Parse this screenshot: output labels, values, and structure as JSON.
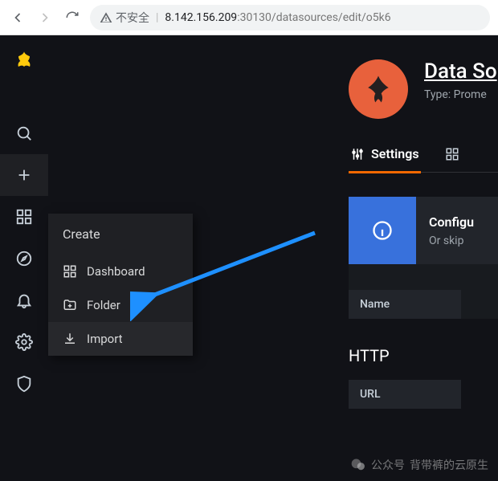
{
  "browser": {
    "insecure_label": "不安全",
    "host": "8.142.156.209",
    "port": ":30130",
    "path": "/datasources/edit/o5k6"
  },
  "submenu": {
    "title": "Create",
    "items": [
      {
        "label": "Dashboard"
      },
      {
        "label": "Folder"
      },
      {
        "label": "Import"
      }
    ]
  },
  "page": {
    "title": "Data So",
    "subtitle": "Type: Prome"
  },
  "tabs": {
    "settings": "Settings"
  },
  "alert": {
    "line1": "Configu",
    "line2": "Or skip "
  },
  "form": {
    "name_label": "Name"
  },
  "http": {
    "heading": "HTTP",
    "url_label": "URL"
  },
  "watermark": {
    "prefix": "公众号",
    "text": "背带裤的云原生"
  }
}
